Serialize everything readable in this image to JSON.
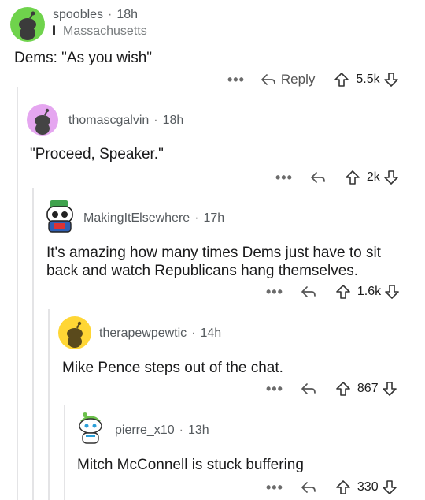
{
  "comments": [
    {
      "user": "spoobles",
      "time": "18h",
      "flair": "Massachusetts",
      "body": "Dems: \"As you wish\"",
      "reply_label": "Reply",
      "score": "5.5k",
      "more": "•••",
      "avatar_color": "#6fd34c"
    },
    {
      "user": "thomascgalvin",
      "time": "18h",
      "body": "\"Proceed, Speaker.\"",
      "score": "2k",
      "more": "•••",
      "avatar_color": "#e5a6f0"
    },
    {
      "user": "MakingItElsewhere",
      "time": "17h",
      "body_line1": "It's amazing how many times Dems just have to sit",
      "body_line2": "back and watch Republicans hang themselves.",
      "score": "1.6k",
      "more": "•••"
    },
    {
      "user": "therapewpewtic",
      "time": "14h",
      "body": "Mike Pence steps out of the chat.",
      "score": "867",
      "more": "•••",
      "avatar_color": "#ffd635"
    },
    {
      "user": "pierre_x10",
      "time": "13h",
      "body": "Mitch McConnell is stuck buffering",
      "score": "330",
      "more": "•••"
    }
  ],
  "separator": "·",
  "icons": {
    "upvote": "arrow-up-icon",
    "downvote": "arrow-down-icon",
    "reply": "reply-arrow-icon",
    "more": "more-dots-icon",
    "location": "location-pin-icon"
  }
}
